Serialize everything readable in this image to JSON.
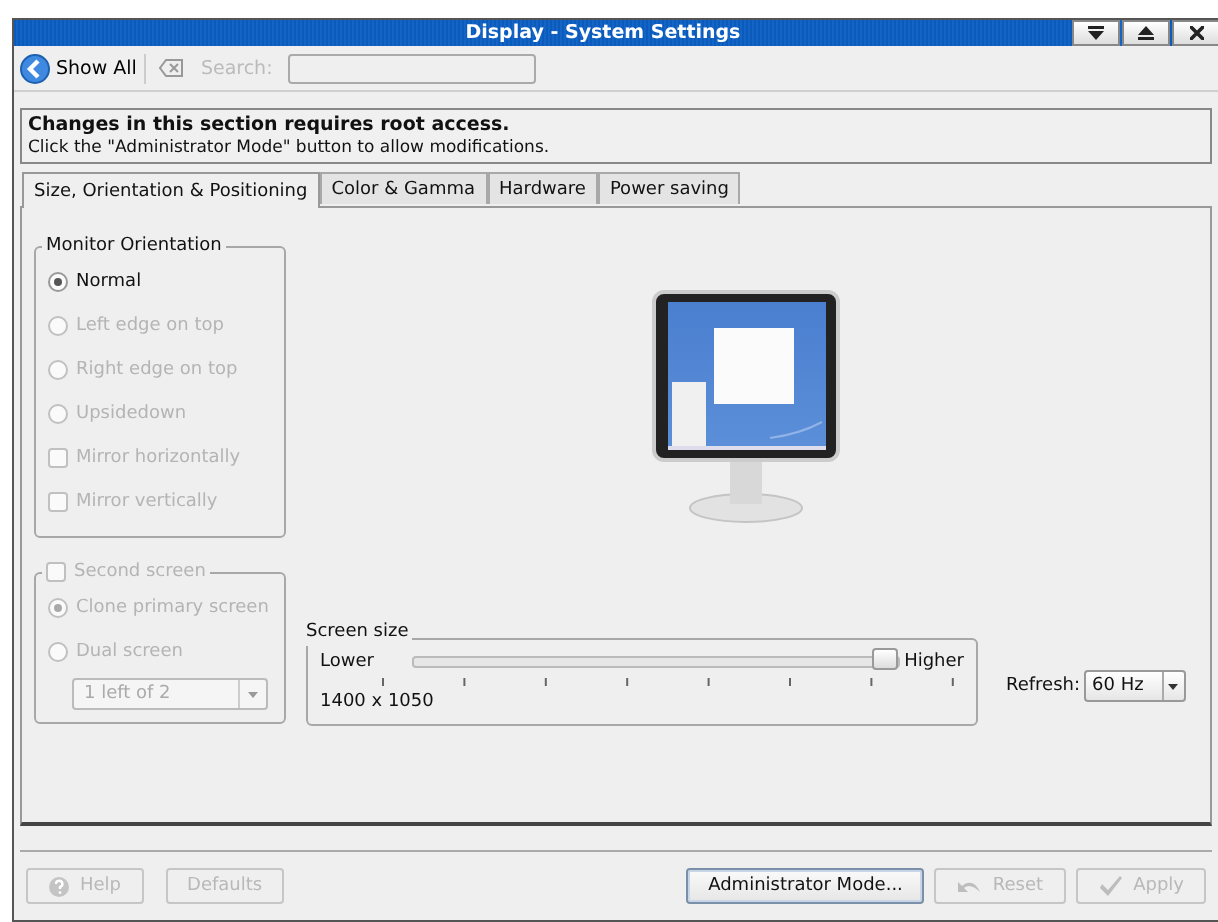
{
  "window": {
    "title": "Display - System Settings"
  },
  "toolbar": {
    "show_all": "Show All",
    "search_label": "Search:"
  },
  "notice": {
    "title": "Changes in this section requires root access.",
    "text": "Click the \"Administrator Mode\" button to allow modifications."
  },
  "tabs": [
    {
      "label": "Size, Orientation & Positioning",
      "selected": true
    },
    {
      "label": "Color & Gamma",
      "selected": false
    },
    {
      "label": "Hardware",
      "selected": false
    },
    {
      "label": "Power saving",
      "selected": false
    }
  ],
  "orientation": {
    "title": "Monitor Orientation",
    "options": [
      {
        "kind": "radio",
        "label": "Normal",
        "checked": true,
        "disabled": false
      },
      {
        "kind": "radio",
        "label": "Left edge on top",
        "checked": false,
        "disabled": true
      },
      {
        "kind": "radio",
        "label": "Right edge on top",
        "checked": false,
        "disabled": true
      },
      {
        "kind": "radio",
        "label": "Upsidedown",
        "checked": false,
        "disabled": true
      },
      {
        "kind": "checkbox",
        "label": "Mirror horizontally",
        "checked": false,
        "disabled": true
      },
      {
        "kind": "checkbox",
        "label": "Mirror vertically",
        "checked": false,
        "disabled": true
      }
    ]
  },
  "second_screen": {
    "label": "Second screen",
    "checked": false,
    "disabled": true,
    "options": [
      {
        "kind": "radio",
        "label": "Clone primary screen",
        "checked": true,
        "disabled": true
      },
      {
        "kind": "radio",
        "label": "Dual screen",
        "checked": false,
        "disabled": true
      }
    ],
    "position": {
      "value": "1 left of 2",
      "disabled": true
    }
  },
  "screen_size": {
    "title": "Screen size",
    "min_label": "Lower",
    "max_label": "Higher",
    "level": 1,
    "reading": "1400 x 1050"
  },
  "refresh": {
    "label": "Refresh:",
    "value": "60 Hz"
  },
  "buttons": [
    {
      "label": "Help",
      "disabled": true
    },
    {
      "label": "Defaults",
      "disabled": true
    },
    {
      "label": "Administrator Mode...",
      "disabled": false
    },
    {
      "label": "Reset",
      "disabled": true
    },
    {
      "label": "Apply",
      "disabled": true
    }
  ]
}
